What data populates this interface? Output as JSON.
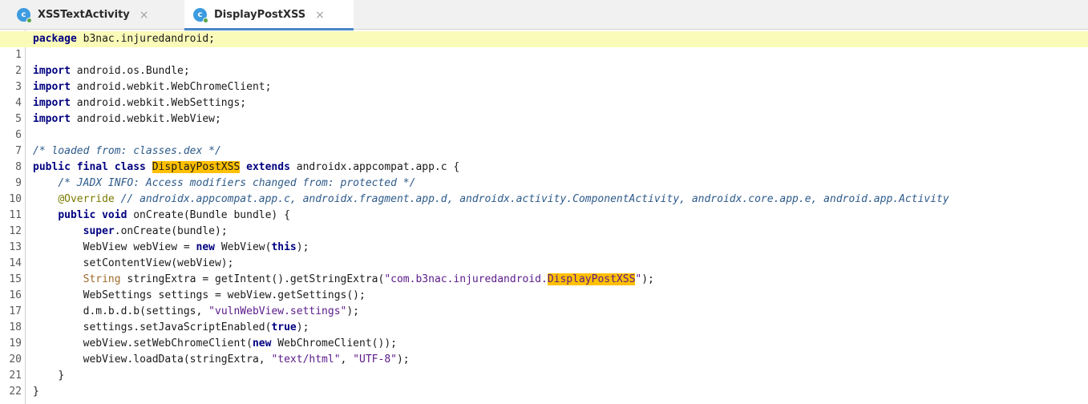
{
  "tabs": [
    {
      "label": "XSSTextActivity",
      "icon_letter": "c",
      "close": "×"
    },
    {
      "label": "DisplayPostXSS",
      "icon_letter": "c",
      "close": "×"
    }
  ],
  "line_numbers": [
    "1",
    "2",
    "3",
    "4",
    "5",
    "6",
    "7",
    "8",
    "9",
    "10",
    "11",
    "12",
    "13",
    "14",
    "15",
    "16",
    "17",
    "18",
    "19",
    "20",
    "21",
    "22"
  ],
  "code": {
    "l1_kw": "package",
    "l1_rest": " b3nac.injuredandroid;",
    "import_kw": "import",
    "l3_rest": " android.os.Bundle;",
    "l4_rest": " android.webkit.WebChromeClient;",
    "l5_rest": " android.webkit.WebSettings;",
    "l6_rest": " android.webkit.WebView;",
    "l8_comment": "/* loaded from: classes.dex */",
    "l9_kw": "public final class",
    "l9_class": "DisplayPostXSS",
    "l9_kw2": "extends",
    "l9_rest": " androidx.appcompat.app.c {",
    "l10_comment": "/* JADX INFO: Access modifiers changed from: protected */",
    "l11_annotation": "@Override",
    "l11_comment": " // androidx.appcompat.app.c, androidx.fragment.app.d, androidx.activity.ComponentActivity, androidx.core.app.e, android.app.Activity",
    "l12_kw": "public void",
    "l12_rest": " onCreate(Bundle bundle) {",
    "l13_kw": "super",
    "l13_rest": ".onCreate(bundle);",
    "l14_pre": "WebView webView = ",
    "l14_kw": "new",
    "l14_mid": " WebView(",
    "l14_kw2": "this",
    "l14_post": ");",
    "l15": "setContentView(webView);",
    "l16_type": "String",
    "l16_mid": " stringExtra = getIntent().getStringExtra(",
    "l16_str": "\"com.b3nac.injuredandroid.",
    "l16_hl": "DisplayPostXSS",
    "l16_str_end": "\"",
    "l16_post": ");",
    "l17": "WebSettings settings = webView.getSettings();",
    "l18_pre": "d.m.b.d.b(settings, ",
    "l18_str": "\"vulnWebView.settings\"",
    "l18_post": ");",
    "l19_pre": "settings.setJavaScriptEnabled(",
    "l19_kw": "true",
    "l19_post": ");",
    "l20_pre": "webView.setWebChromeClient(",
    "l20_kw": "new",
    "l20_post": " WebChromeClient());",
    "l21_pre": "webView.loadData(stringExtra, ",
    "l21_str1": "\"text/html\"",
    "l21_sep": ", ",
    "l21_str2": "\"UTF-8\"",
    "l21_post": ");",
    "l22": "}",
    "l23": "}"
  }
}
